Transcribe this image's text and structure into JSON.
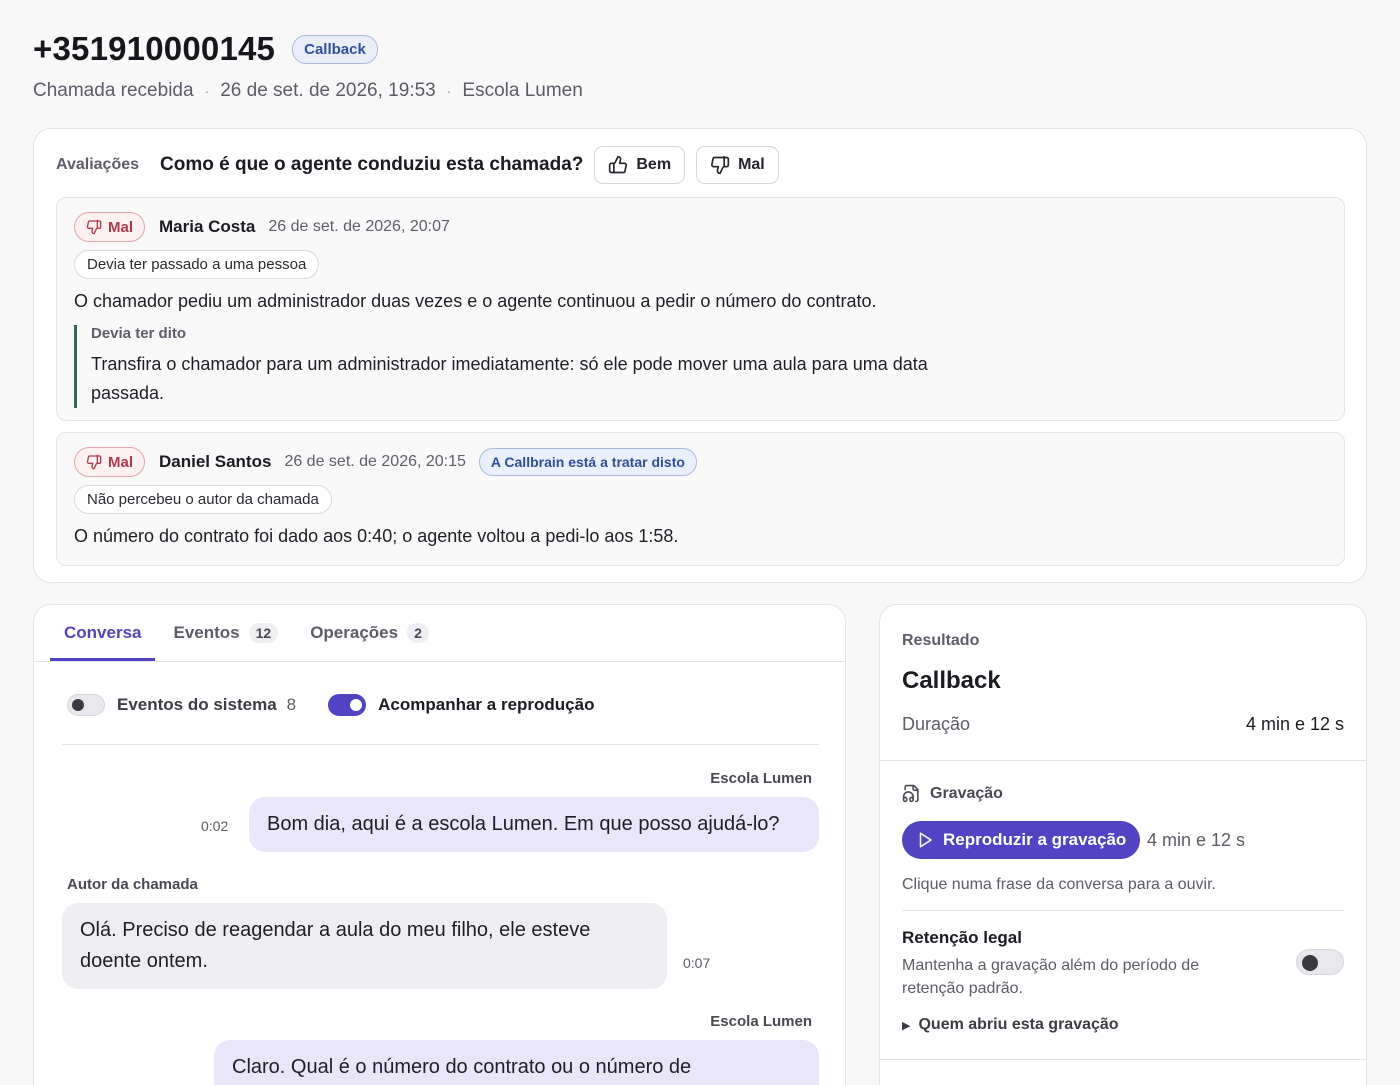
{
  "header": {
    "phone": "+351910000145",
    "status_badge": "Callback",
    "call_type": "Chamada recebida",
    "datetime": "26 de set. de 2026, 19:53",
    "organization": "Escola Lumen",
    "separator": "·"
  },
  "evaluations": {
    "label": "Avaliações",
    "question": "Como é que o agente conduziu esta chamada?",
    "good_label": "Bem",
    "bad_label": "Mal",
    "reviews": [
      {
        "verdict": "Mal",
        "reviewer": "Maria Costa",
        "date": "26 de set. de 2026, 20:07",
        "tag": "Devia ter passado a uma pessoa",
        "comment": "O chamador pediu um administrador duas vezes e o agente continuou a pedir o número do contrato.",
        "should_have_said_label": "Devia ter dito",
        "should_have_said": "Transfira o chamador para um administrador imediatamente: só ele pode mover uma aula para uma data passada."
      },
      {
        "verdict": "Mal",
        "reviewer": "Daniel Santos",
        "date": "26 de set. de 2026, 20:15",
        "status": "A Callbrain está a tratar disto",
        "tag": "Não percebeu o autor da chamada",
        "comment": "O número do contrato foi dado aos 0:40; o agente voltou a pedi-lo aos 1:58."
      }
    ]
  },
  "conversation": {
    "tabs": [
      {
        "label": "Conversa",
        "count": ""
      },
      {
        "label": "Eventos",
        "count": "12"
      },
      {
        "label": "Operações",
        "count": "2"
      }
    ],
    "system_events_label": "Eventos do sistema",
    "system_events_count": "8",
    "follow_playback_label": "Acompanhar a reprodução",
    "messages": [
      {
        "speaker": "Escola Lumen",
        "text": "Bom dia, aqui é a escola Lumen. Em que posso ajudá-lo?",
        "time": "0:02"
      },
      {
        "speaker": "Autor da chamada",
        "text": "Olá. Preciso de reagendar a aula do meu filho, ele esteve doente ontem.",
        "time": "0:07"
      },
      {
        "speaker": "Escola Lumen",
        "text": "Claro. Qual é o número do contrato ou o número de"
      }
    ]
  },
  "result": {
    "label": "Resultado",
    "value": "Callback",
    "duration_label": "Duração",
    "duration_value": "4 min e 12 s",
    "recording_label": "Gravação",
    "play_label": "Reproduzir a gravação",
    "recording_duration": "4 min e 12 s",
    "recording_hint": "Clique numa frase da conversa para a ouvir.",
    "retention_title": "Retenção legal",
    "retention_desc": "Mantenha a gravação além do período de retenção padrão.",
    "opened_by_label": "Quem abriu esta gravação"
  },
  "colors": {
    "accent": "#5143c4",
    "negative": "#b23a48",
    "info": "#2f4f9c",
    "agent_bubble": "#e9e6fb",
    "caller_bubble": "#eeeef2"
  }
}
